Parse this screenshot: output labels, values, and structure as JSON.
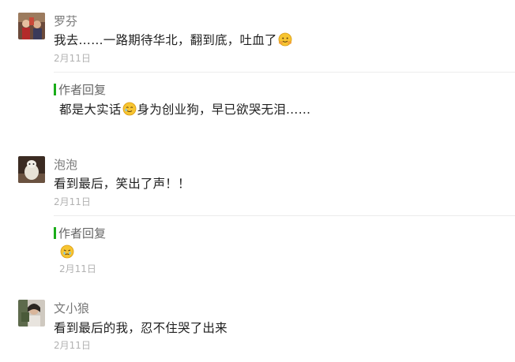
{
  "comments": [
    {
      "author": "罗芬",
      "text": "我去……一路期待华北，翻到底，吐血了",
      "emoji": "hug-emoji",
      "date": "2月11日",
      "reply": {
        "label": "作者回复",
        "text_before": "都是大实话",
        "emoji": "tearful-smile-emoji",
        "text_after": "身为创业狗，早已欲哭无泪……"
      }
    },
    {
      "author": "泡泡",
      "text": "看到最后，笑出了声！！",
      "date": "2月11日",
      "reply": {
        "label": "作者回复",
        "emoji": "crying-emoji",
        "date": "2月11日"
      }
    },
    {
      "author": "文小狼",
      "text": "看到最后的我，忍不住哭了出来",
      "date": "2月11日"
    }
  ],
  "colors": {
    "accent": "#1aad19",
    "name": "#777777",
    "date": "#b2b2b2",
    "text": "#1f1f1f"
  }
}
